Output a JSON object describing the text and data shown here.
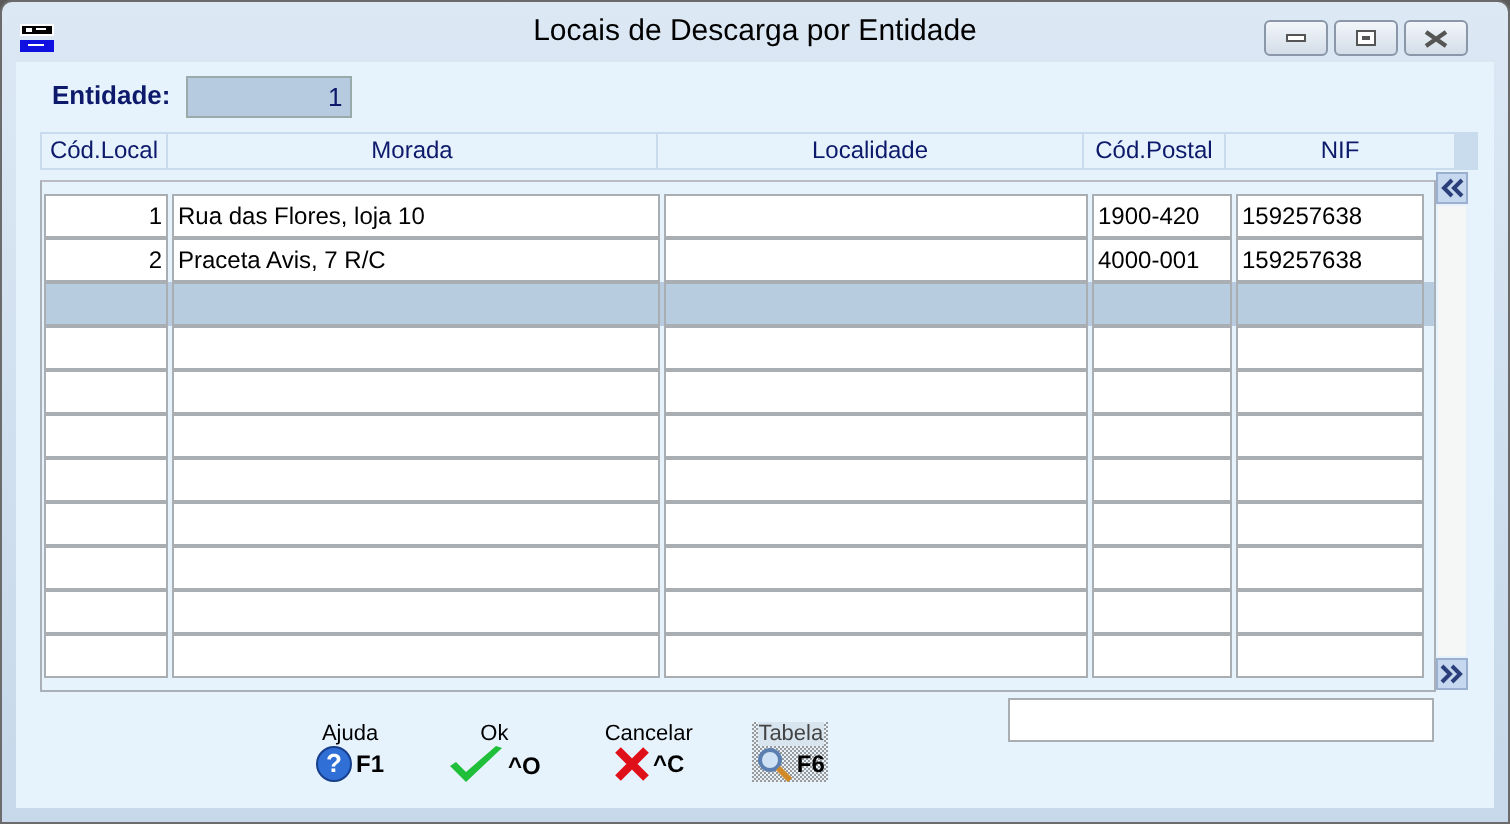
{
  "window": {
    "title": "Locais de Descarga por Entidade"
  },
  "entity": {
    "label": "Entidade:",
    "value": "1"
  },
  "table": {
    "columns": [
      "Cód.Local",
      "Morada",
      "Localidade",
      "Cód.Postal",
      "NIF"
    ],
    "rows": [
      {
        "cells": [
          "1",
          "Rua das Flores, loja 10",
          null,
          "1900-420",
          "159257638"
        ],
        "selected": false
      },
      {
        "cells": [
          "2",
          "Praceta Avis, 7 R/C",
          null,
          "4000-001",
          "159257638"
        ],
        "selected": false
      },
      {
        "selected": true
      },
      {
        "selected": false
      },
      {
        "selected": false
      },
      {
        "selected": false
      },
      {
        "selected": false
      },
      {
        "selected": false
      },
      {
        "selected": false
      },
      {
        "selected": false
      },
      {
        "selected": false
      }
    ]
  },
  "buttons": [
    {
      "kind": "help",
      "label": "Ajuda",
      "icon": "?",
      "shortcut": "F1",
      "disabled": false
    },
    {
      "kind": "ok",
      "label": "Ok",
      "shortcut": "^O",
      "disabled": false
    },
    {
      "kind": "cancel",
      "label": "Cancelar",
      "shortcut": "^C",
      "disabled": false
    },
    {
      "kind": "table",
      "label": "Tabela",
      "shortcut": "F6",
      "disabled": true
    }
  ]
}
